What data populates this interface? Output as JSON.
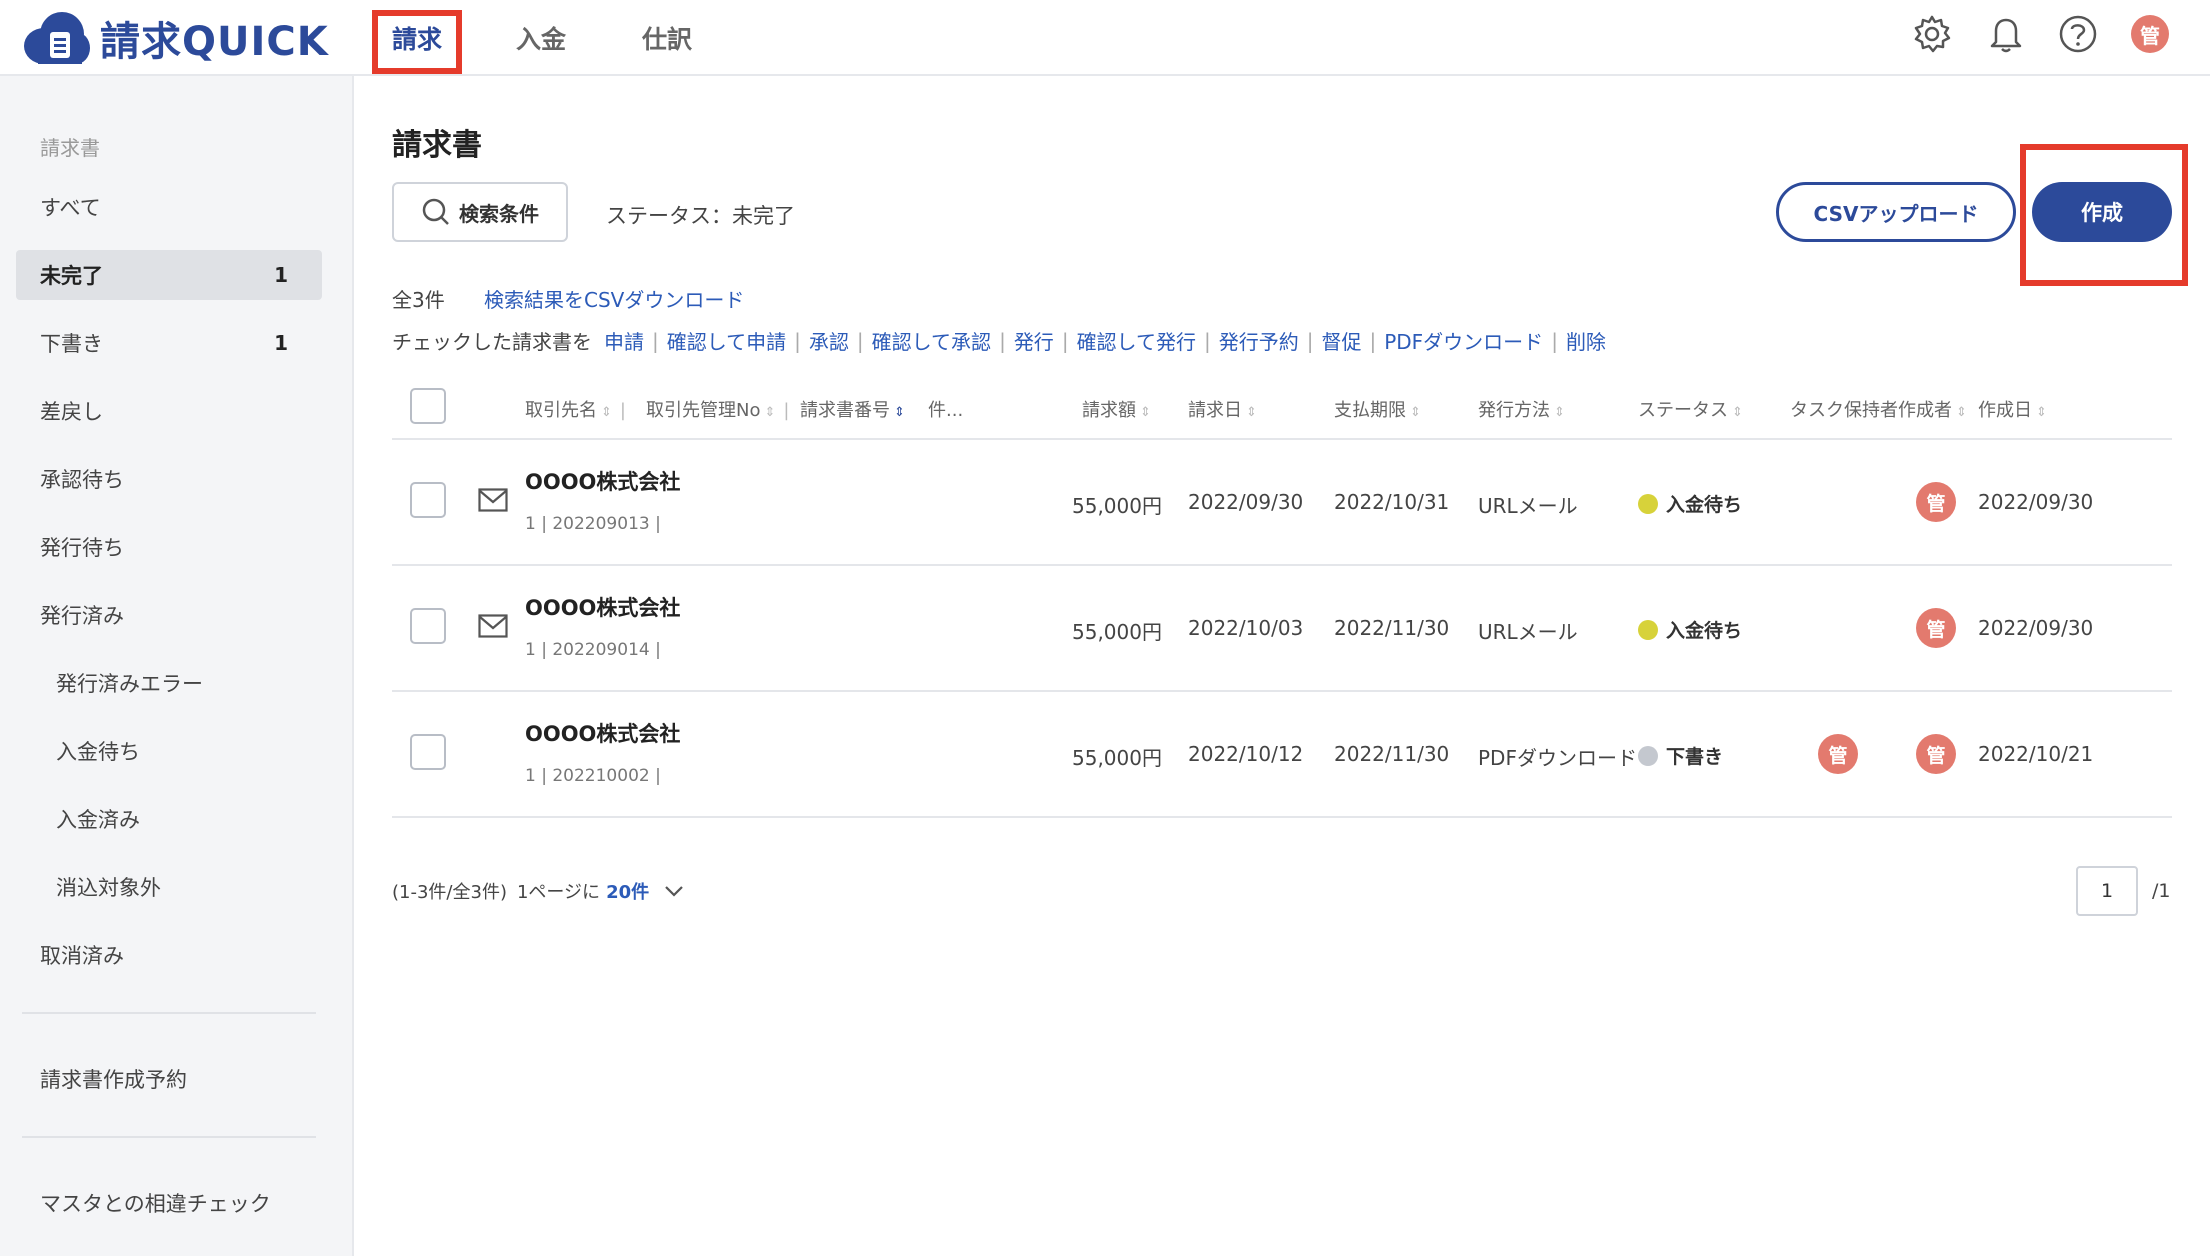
{
  "app": {
    "name": "請求QUICK"
  },
  "nav": {
    "tabs": [
      {
        "label": "請求"
      },
      {
        "label": "入金"
      },
      {
        "label": "仕訳"
      }
    ]
  },
  "header": {
    "avatar": "管"
  },
  "sidebar": {
    "heading": "請求書",
    "items": [
      {
        "label": "すべて",
        "count": ""
      },
      {
        "label": "未完了",
        "count": "1"
      },
      {
        "label": "下書き",
        "count": "1"
      },
      {
        "label": "差戻し",
        "count": ""
      },
      {
        "label": "承認待ち",
        "count": ""
      },
      {
        "label": "発行待ち",
        "count": ""
      },
      {
        "label": "発行済み",
        "count": ""
      },
      {
        "label": "発行済みエラー",
        "count": ""
      },
      {
        "label": "入金待ち",
        "count": ""
      },
      {
        "label": "入金済み",
        "count": ""
      },
      {
        "label": "消込対象外",
        "count": ""
      },
      {
        "label": "取消済み",
        "count": ""
      }
    ],
    "schedule": "請求書作成予約",
    "master_check": "マスタとの相違チェック"
  },
  "main": {
    "title": "請求書",
    "search_label": "検索条件",
    "status_filter": "ステータス：未完了",
    "csv_upload": "CSVアップロード",
    "create": "作成",
    "total_count": "全3件",
    "csv_download": "検索結果をCSVダウンロード",
    "bulk_prefix": "チェックした請求書を",
    "bulk_actions": [
      "申請",
      "確認して申請",
      "承認",
      "確認して承認",
      "発行",
      "確認して発行",
      "発行予約",
      "督促",
      "PDFダウンロード",
      "削除"
    ]
  },
  "table": {
    "columns": [
      "取引先名",
      "取引先管理No",
      "請求書番号",
      "件...",
      "請求額",
      "請求日",
      "支払期限",
      "発行方法",
      "ステータス",
      "タスク保持者",
      "作成者",
      "作成日"
    ],
    "rows": [
      {
        "name": "OOOO株式会社",
        "sub": "1 | 202209013 |",
        "amount": "55,000円",
        "invoice_date": "2022/09/30",
        "due_date": "2022/10/31",
        "method": "URLメール",
        "status": "入金待ち",
        "status_color": "#d7d23a",
        "task_holder": "",
        "creator": "管",
        "created": "2022/09/30",
        "mail": true
      },
      {
        "name": "OOOO株式会社",
        "sub": "1 | 202209014 |",
        "amount": "55,000円",
        "invoice_date": "2022/10/03",
        "due_date": "2022/11/30",
        "method": "URLメール",
        "status": "入金待ち",
        "status_color": "#d7d23a",
        "task_holder": "",
        "creator": "管",
        "created": "2022/09/30",
        "mail": true
      },
      {
        "name": "OOOO株式会社",
        "sub": "1 | 202210002 |",
        "amount": "55,000円",
        "invoice_date": "2022/10/12",
        "due_date": "2022/11/30",
        "method": "PDFダウンロード",
        "status": "下書き",
        "status_color": "#c4c8cf",
        "task_holder": "管",
        "creator": "管",
        "created": "2022/10/21",
        "mail": false
      }
    ]
  },
  "pager": {
    "range": "(1-3件/全3件)",
    "per_page_prefix": "1ページに",
    "per_page": "20件",
    "current": "1",
    "total": "/1"
  },
  "colors": {
    "brand": "#2c4a9a",
    "highlight": "#e53b2b",
    "avatar": "#e37a6e"
  }
}
